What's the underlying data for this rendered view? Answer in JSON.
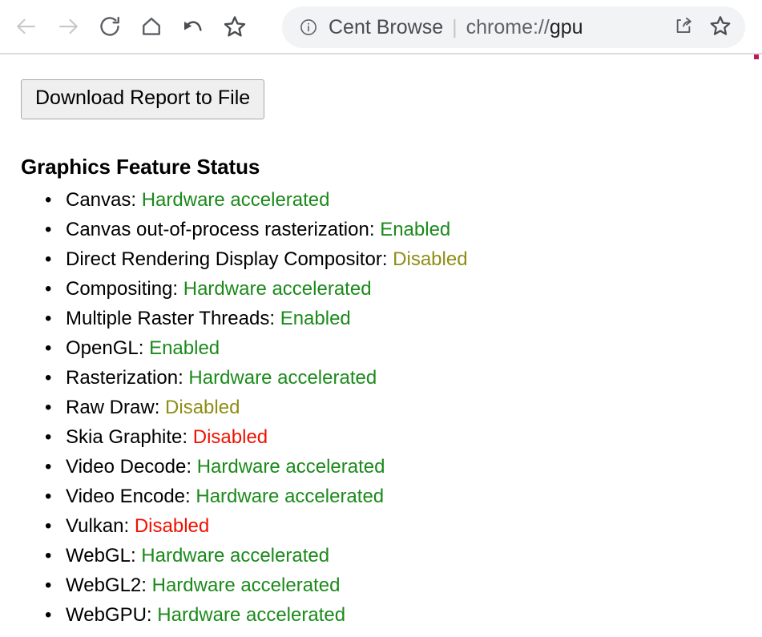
{
  "browser": {
    "nav": [
      {
        "name": "back-button",
        "icon": "arrow-left-icon",
        "label": "Back",
        "state": "disabled"
      },
      {
        "name": "forward-button",
        "icon": "arrow-right-icon",
        "label": "Forward",
        "state": "disabled"
      },
      {
        "name": "reload-button",
        "icon": "reload-icon",
        "label": "Reload",
        "state": "enabled"
      },
      {
        "name": "home-button",
        "icon": "home-icon",
        "label": "Home",
        "state": "enabled"
      },
      {
        "name": "undo-button",
        "icon": "undo-arrow-icon",
        "label": "Undo",
        "state": "enabled"
      },
      {
        "name": "favorites-button",
        "icon": "star-outline-icon",
        "label": "Favorites",
        "state": "enabled"
      }
    ],
    "omnibox": {
      "site_info_icon": "info-circle-icon",
      "site_name": "Cent Browse",
      "separator": "|",
      "url_scheme": "chrome://",
      "url_host": "gpu",
      "full_url": "chrome://gpu",
      "actions": [
        {
          "name": "share-button",
          "icon": "share-icon",
          "label": "Share"
        },
        {
          "name": "bookmark-button",
          "icon": "star-outline-icon",
          "label": "Bookmark this page"
        }
      ]
    }
  },
  "page": {
    "download_button_label": "Download Report to File",
    "heading": "Graphics Feature Status",
    "features": [
      {
        "name": "Canvas",
        "value": "Hardware accelerated",
        "status": "green"
      },
      {
        "name": "Canvas out-of-process rasterization",
        "value": "Enabled",
        "status": "green"
      },
      {
        "name": "Direct Rendering Display Compositor",
        "value": "Disabled",
        "status": "olive"
      },
      {
        "name": "Compositing",
        "value": "Hardware accelerated",
        "status": "green"
      },
      {
        "name": "Multiple Raster Threads",
        "value": "Enabled",
        "status": "green"
      },
      {
        "name": "OpenGL",
        "value": "Enabled",
        "status": "green"
      },
      {
        "name": "Rasterization",
        "value": "Hardware accelerated",
        "status": "green"
      },
      {
        "name": "Raw Draw",
        "value": "Disabled",
        "status": "olive"
      },
      {
        "name": "Skia Graphite",
        "value": "Disabled",
        "status": "red"
      },
      {
        "name": "Video Decode",
        "value": "Hardware accelerated",
        "status": "green"
      },
      {
        "name": "Video Encode",
        "value": "Hardware accelerated",
        "status": "green"
      },
      {
        "name": "Vulkan",
        "value": "Disabled",
        "status": "red"
      },
      {
        "name": "WebGL",
        "value": "Hardware accelerated",
        "status": "green"
      },
      {
        "name": "WebGL2",
        "value": "Hardware accelerated",
        "status": "green"
      },
      {
        "name": "WebGPU",
        "value": "Hardware accelerated",
        "status": "green"
      }
    ],
    "bullet_glyph": "•"
  },
  "colors": {
    "status_green": "#1b8a1b",
    "status_olive": "#8e8e15",
    "status_red": "#ee1100",
    "omnibox_bg": "#f1f3f4",
    "button_bg": "#efefef",
    "toolbar_divider": "#dcdcdc",
    "marker": "#c2185b"
  }
}
